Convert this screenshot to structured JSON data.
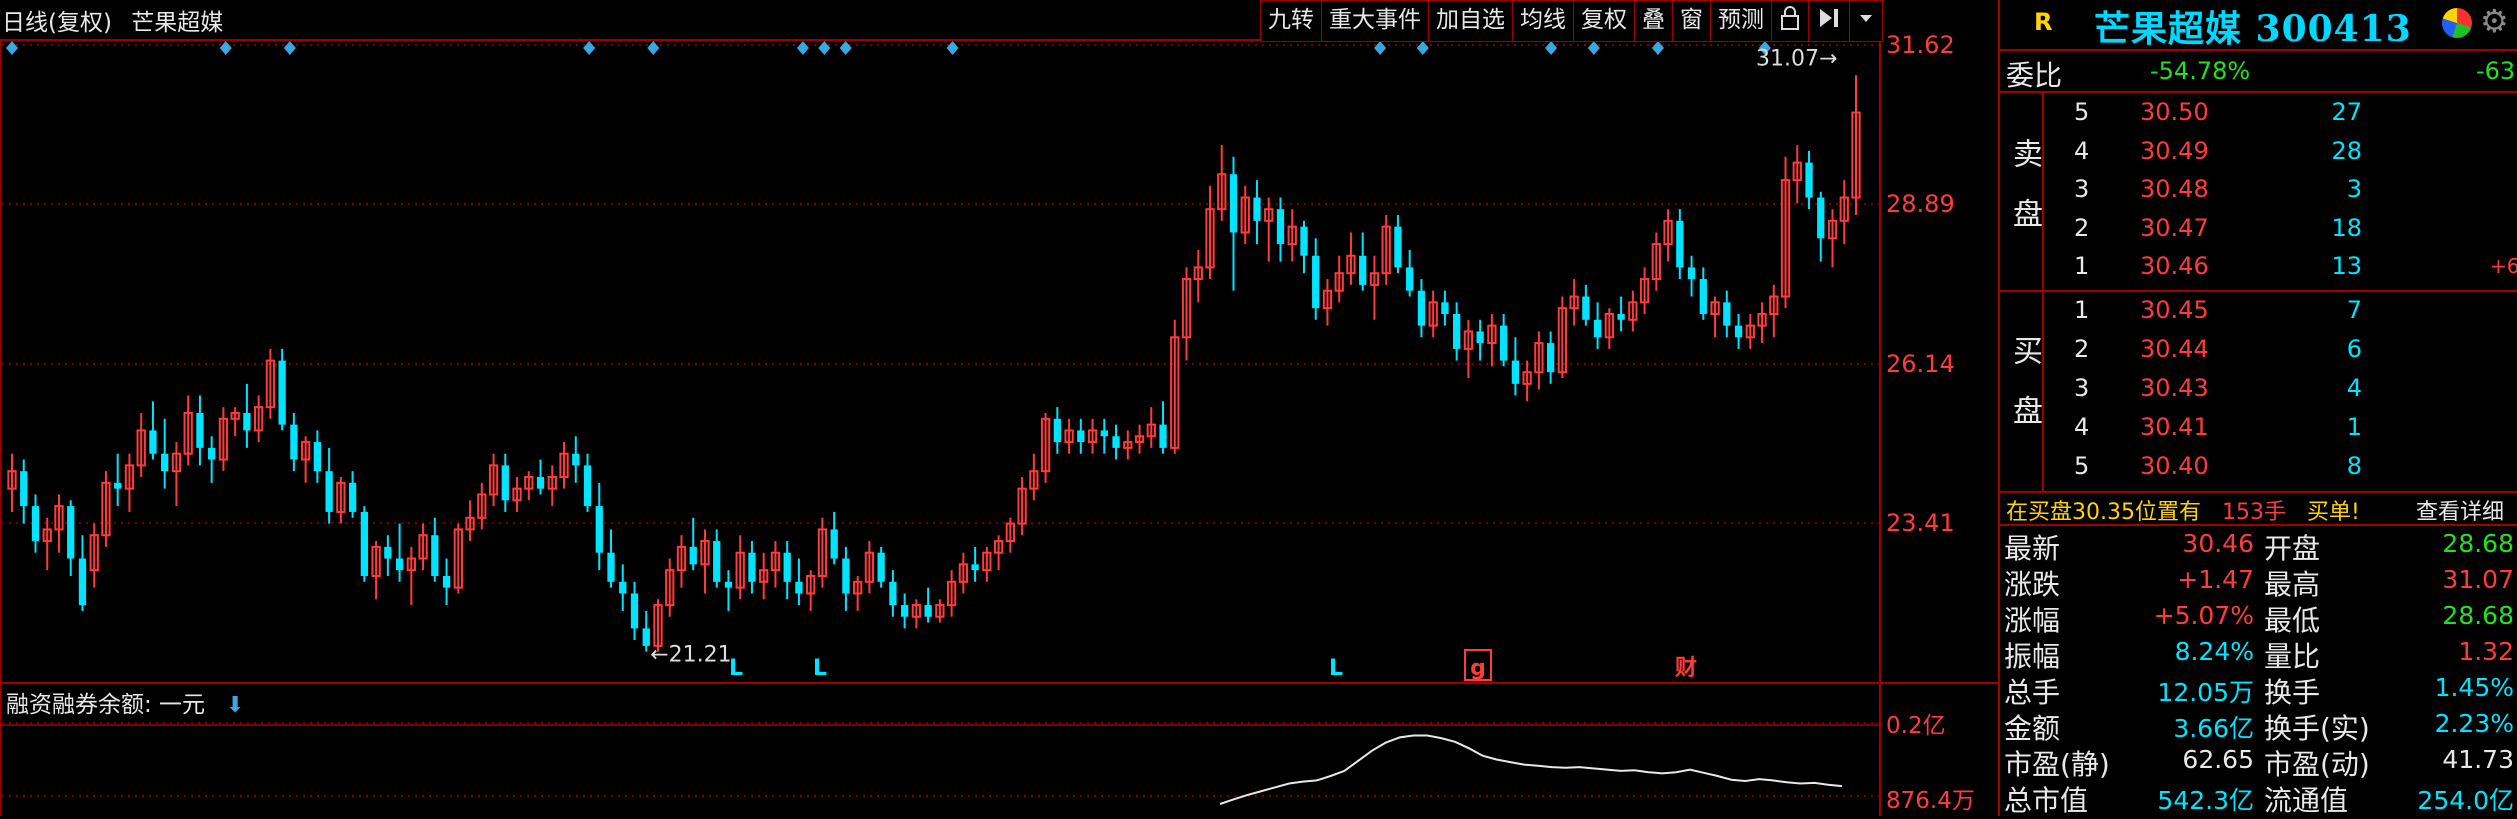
{
  "left_header": {
    "period_label": "日线(复权)",
    "stock_name": "芒果超媒"
  },
  "toolbar": {
    "items": [
      "九转",
      "重大事件",
      "加自选",
      "均线",
      "复权",
      "叠",
      "窗",
      "预测"
    ]
  },
  "price_axis": {
    "labels": [
      "31.62",
      "28.89",
      "26.14",
      "23.41"
    ],
    "values": [
      31.62,
      28.89,
      26.14,
      23.41
    ]
  },
  "annotations": {
    "high_label": "31.07",
    "low_label": "21.21",
    "markers": [
      "L",
      "L",
      "L",
      "g",
      "财"
    ]
  },
  "lower_panel": {
    "title": "融资融券余额: 一元",
    "axis_labels": [
      "0.2亿",
      "876.4万"
    ]
  },
  "colors": {
    "up": "#ff3b3b",
    "down": "#00e5ff",
    "grid": "#a00000",
    "axis_text": "#ff3b3b"
  },
  "chart_data": {
    "type": "candlestick",
    "ylim": [
      20.5,
      31.9
    ],
    "candles": [
      [
        24.0,
        24.6,
        23.6,
        24.3
      ],
      [
        24.3,
        24.5,
        23.4,
        23.7
      ],
      [
        23.7,
        23.9,
        22.9,
        23.1
      ],
      [
        23.1,
        23.5,
        22.6,
        23.3
      ],
      [
        23.3,
        23.9,
        22.9,
        23.7
      ],
      [
        23.7,
        23.8,
        22.5,
        22.8
      ],
      [
        22.8,
        23.2,
        21.9,
        22.0
      ],
      [
        22.6,
        23.4,
        22.3,
        23.2
      ],
      [
        23.2,
        24.3,
        23.0,
        24.1
      ],
      [
        24.1,
        24.6,
        23.7,
        24.0
      ],
      [
        24.0,
        24.6,
        23.6,
        24.4
      ],
      [
        24.4,
        25.3,
        24.2,
        25.0
      ],
      [
        25.0,
        25.5,
        24.5,
        24.6
      ],
      [
        24.6,
        25.2,
        24.0,
        24.3
      ],
      [
        24.3,
        24.8,
        23.7,
        24.6
      ],
      [
        24.6,
        25.6,
        24.4,
        25.3
      ],
      [
        25.3,
        25.6,
        24.4,
        24.7
      ],
      [
        24.7,
        24.9,
        24.1,
        24.5
      ],
      [
        24.5,
        25.4,
        24.3,
        25.2
      ],
      [
        25.2,
        25.4,
        24.9,
        25.3
      ],
      [
        25.3,
        25.8,
        24.7,
        25.0
      ],
      [
        25.0,
        25.6,
        24.8,
        25.4
      ],
      [
        25.4,
        26.4,
        25.2,
        26.2
      ],
      [
        26.2,
        26.4,
        25.0,
        25.1
      ],
      [
        25.1,
        25.3,
        24.3,
        24.5
      ],
      [
        24.5,
        24.9,
        24.1,
        24.8
      ],
      [
        24.8,
        25.0,
        24.1,
        24.3
      ],
      [
        24.3,
        24.7,
        23.4,
        23.6
      ],
      [
        23.6,
        24.2,
        23.4,
        24.1
      ],
      [
        24.1,
        24.3,
        23.5,
        23.6
      ],
      [
        23.6,
        23.7,
        22.4,
        22.5
      ],
      [
        22.5,
        23.1,
        22.1,
        23.0
      ],
      [
        23.0,
        23.2,
        22.5,
        22.8
      ],
      [
        22.8,
        23.4,
        22.4,
        22.6
      ],
      [
        22.6,
        23.0,
        22.0,
        22.8
      ],
      [
        22.8,
        23.4,
        22.6,
        23.2
      ],
      [
        23.2,
        23.5,
        22.4,
        22.5
      ],
      [
        22.5,
        22.8,
        22.0,
        22.3
      ],
      [
        22.3,
        23.4,
        22.2,
        23.3
      ],
      [
        23.3,
        23.8,
        23.1,
        23.5
      ],
      [
        23.5,
        24.1,
        23.3,
        23.9
      ],
      [
        23.9,
        24.6,
        23.7,
        24.4
      ],
      [
        24.4,
        24.6,
        23.6,
        23.8
      ],
      [
        23.8,
        24.2,
        23.6,
        24.0
      ],
      [
        24.0,
        24.3,
        23.8,
        24.2
      ],
      [
        24.2,
        24.5,
        23.9,
        24.0
      ],
      [
        24.0,
        24.4,
        23.7,
        24.2
      ],
      [
        24.2,
        24.8,
        24.0,
        24.6
      ],
      [
        24.6,
        24.9,
        24.1,
        24.4
      ],
      [
        24.4,
        24.6,
        23.6,
        23.7
      ],
      [
        23.7,
        24.1,
        22.6,
        22.9
      ],
      [
        22.9,
        23.3,
        22.3,
        22.4
      ],
      [
        22.4,
        22.7,
        21.9,
        22.2
      ],
      [
        22.2,
        22.4,
        21.4,
        21.6
      ],
      [
        21.6,
        21.9,
        21.2,
        21.3
      ],
      [
        21.3,
        22.1,
        21.2,
        22.0
      ],
      [
        22.0,
        22.8,
        21.8,
        22.6
      ],
      [
        22.6,
        23.2,
        22.3,
        23.0
      ],
      [
        23.0,
        23.5,
        22.6,
        22.7
      ],
      [
        22.7,
        23.3,
        22.2,
        23.1
      ],
      [
        23.1,
        23.3,
        22.3,
        22.4
      ],
      [
        22.4,
        22.6,
        21.9,
        22.3
      ],
      [
        22.3,
        23.2,
        22.1,
        22.9
      ],
      [
        22.9,
        23.1,
        22.2,
        22.4
      ],
      [
        22.4,
        22.9,
        22.1,
        22.6
      ],
      [
        22.6,
        23.1,
        22.3,
        22.9
      ],
      [
        22.9,
        23.1,
        22.1,
        22.4
      ],
      [
        22.4,
        22.8,
        22.0,
        22.2
      ],
      [
        22.2,
        22.6,
        21.9,
        22.5
      ],
      [
        22.5,
        23.5,
        22.3,
        23.3
      ],
      [
        23.3,
        23.6,
        22.7,
        22.8
      ],
      [
        22.8,
        23.0,
        21.9,
        22.2
      ],
      [
        22.2,
        22.5,
        21.9,
        22.4
      ],
      [
        22.4,
        23.1,
        22.2,
        22.9
      ],
      [
        22.9,
        23.0,
        22.3,
        22.4
      ],
      [
        22.4,
        22.6,
        21.8,
        22.0
      ],
      [
        22.0,
        22.2,
        21.6,
        21.8
      ],
      [
        21.8,
        22.1,
        21.6,
        22.0
      ],
      [
        22.0,
        22.3,
        21.7,
        21.8
      ],
      [
        21.8,
        22.1,
        21.7,
        22.0
      ],
      [
        22.0,
        22.6,
        21.8,
        22.4
      ],
      [
        22.4,
        22.9,
        22.2,
        22.7
      ],
      [
        22.7,
        23.0,
        22.4,
        22.6
      ],
      [
        22.6,
        23.0,
        22.4,
        22.9
      ],
      [
        22.9,
        23.2,
        22.6,
        23.1
      ],
      [
        23.1,
        23.5,
        22.9,
        23.4
      ],
      [
        23.4,
        24.2,
        23.2,
        24.0
      ],
      [
        24.0,
        24.6,
        23.8,
        24.3
      ],
      [
        24.3,
        25.3,
        24.1,
        25.2
      ],
      [
        25.2,
        25.4,
        24.6,
        24.8
      ],
      [
        24.8,
        25.2,
        24.6,
        25.0
      ],
      [
        25.0,
        25.2,
        24.6,
        24.8
      ],
      [
        24.8,
        25.2,
        24.6,
        25.0
      ],
      [
        25.0,
        25.2,
        24.6,
        24.9
      ],
      [
        24.9,
        25.1,
        24.5,
        24.7
      ],
      [
        24.7,
        25.0,
        24.5,
        24.8
      ],
      [
        24.8,
        25.1,
        24.6,
        24.9
      ],
      [
        24.9,
        25.4,
        24.7,
        25.1
      ],
      [
        25.1,
        25.5,
        24.6,
        24.7
      ],
      [
        24.7,
        26.9,
        24.6,
        26.6
      ],
      [
        26.6,
        27.8,
        26.2,
        27.6
      ],
      [
        27.6,
        28.1,
        27.2,
        27.8
      ],
      [
        27.8,
        29.2,
        27.6,
        28.8
      ],
      [
        28.8,
        29.9,
        28.6,
        29.4
      ],
      [
        29.4,
        29.7,
        27.4,
        28.4
      ],
      [
        28.4,
        29.2,
        28.2,
        29.0
      ],
      [
        29.0,
        29.3,
        28.2,
        28.6
      ],
      [
        28.6,
        29.0,
        27.9,
        28.8
      ],
      [
        28.8,
        29.0,
        27.9,
        28.2
      ],
      [
        28.2,
        28.8,
        27.9,
        28.5
      ],
      [
        28.5,
        28.6,
        27.7,
        28.0
      ],
      [
        28.0,
        28.3,
        26.9,
        27.1
      ],
      [
        27.1,
        27.6,
        26.8,
        27.4
      ],
      [
        27.4,
        28.0,
        27.2,
        27.7
      ],
      [
        27.7,
        28.4,
        27.5,
        28.0
      ],
      [
        28.0,
        28.4,
        27.4,
        27.5
      ],
      [
        27.5,
        28.0,
        26.9,
        27.7
      ],
      [
        27.7,
        28.7,
        27.5,
        28.5
      ],
      [
        28.5,
        28.7,
        27.7,
        27.8
      ],
      [
        27.8,
        28.1,
        27.3,
        27.4
      ],
      [
        27.4,
        27.6,
        26.6,
        26.8
      ],
      [
        26.8,
        27.4,
        26.6,
        27.2
      ],
      [
        27.2,
        27.4,
        26.8,
        27.0
      ],
      [
        27.0,
        27.2,
        26.2,
        26.4
      ],
      [
        26.4,
        26.9,
        25.9,
        26.7
      ],
      [
        26.7,
        26.9,
        26.2,
        26.5
      ],
      [
        26.5,
        27.0,
        26.1,
        26.8
      ],
      [
        26.8,
        27.0,
        26.1,
        26.2
      ],
      [
        26.2,
        26.6,
        25.6,
        25.8
      ],
      [
        25.8,
        26.2,
        25.5,
        26.0
      ],
      [
        26.0,
        26.7,
        25.7,
        26.5
      ],
      [
        26.5,
        26.7,
        25.8,
        26.0
      ],
      [
        26.0,
        27.3,
        25.9,
        27.1
      ],
      [
        27.1,
        27.6,
        26.8,
        27.3
      ],
      [
        27.3,
        27.5,
        26.8,
        26.9
      ],
      [
        26.9,
        27.2,
        26.4,
        26.6
      ],
      [
        26.6,
        27.1,
        26.4,
        27.0
      ],
      [
        27.0,
        27.3,
        26.7,
        26.9
      ],
      [
        26.9,
        27.4,
        26.7,
        27.2
      ],
      [
        27.2,
        27.8,
        27.0,
        27.6
      ],
      [
        27.6,
        28.4,
        27.4,
        28.2
      ],
      [
        28.2,
        28.8,
        27.9,
        28.6
      ],
      [
        28.6,
        28.8,
        27.6,
        27.8
      ],
      [
        27.8,
        28.0,
        27.3,
        27.6
      ],
      [
        27.6,
        27.8,
        26.9,
        27.0
      ],
      [
        27.0,
        27.3,
        26.6,
        27.2
      ],
      [
        27.2,
        27.4,
        26.6,
        26.8
      ],
      [
        26.8,
        27.0,
        26.4,
        26.6
      ],
      [
        26.6,
        27.0,
        26.4,
        26.8
      ],
      [
        26.8,
        27.2,
        26.5,
        27.0
      ],
      [
        27.0,
        27.5,
        26.6,
        27.3
      ],
      [
        27.3,
        29.7,
        27.1,
        29.3
      ],
      [
        29.3,
        29.9,
        28.9,
        29.6
      ],
      [
        29.6,
        29.8,
        28.8,
        29.0
      ],
      [
        29.0,
        29.1,
        27.9,
        28.3
      ],
      [
        28.3,
        28.8,
        27.8,
        28.6
      ],
      [
        28.6,
        29.3,
        28.2,
        29.0
      ],
      [
        29.0,
        31.1,
        28.7,
        30.46
      ]
    ],
    "lower_series": [
      0.00876,
      0.0095,
      0.0102,
      0.0108,
      0.0114,
      0.012,
      0.0123,
      0.0125,
      0.0132,
      0.014,
      0.0156,
      0.0172,
      0.0185,
      0.0193,
      0.0196,
      0.0196,
      0.0192,
      0.0186,
      0.0176,
      0.0164,
      0.0158,
      0.0154,
      0.015,
      0.0148,
      0.0146,
      0.0145,
      0.0146,
      0.0144,
      0.0142,
      0.014,
      0.0141,
      0.0138,
      0.0136,
      0.0138,
      0.0142,
      0.0137,
      0.0132,
      0.0126,
      0.0124,
      0.0127,
      0.0125,
      0.0122,
      0.012,
      0.0121,
      0.0118,
      0.0116
    ]
  },
  "quote": {
    "title": "芒果超媒 300413",
    "r_label": "R",
    "weibi": {
      "label": "委比",
      "pct": "-54.78%",
      "diff": "-63"
    },
    "sell_label": "卖盘",
    "buy_label": "买盘",
    "sells": [
      {
        "lvl": "5",
        "price": "30.50",
        "vol": "27",
        "chg": ""
      },
      {
        "lvl": "4",
        "price": "30.49",
        "vol": "28",
        "chg": ""
      },
      {
        "lvl": "3",
        "price": "30.48",
        "vol": "3",
        "chg": ""
      },
      {
        "lvl": "2",
        "price": "30.47",
        "vol": "18",
        "chg": ""
      },
      {
        "lvl": "1",
        "price": "30.46",
        "vol": "13",
        "chg": "+6"
      }
    ],
    "buys": [
      {
        "lvl": "1",
        "price": "30.45",
        "vol": "7"
      },
      {
        "lvl": "2",
        "price": "30.44",
        "vol": "6"
      },
      {
        "lvl": "3",
        "price": "30.43",
        "vol": "4"
      },
      {
        "lvl": "4",
        "price": "30.41",
        "vol": "1"
      },
      {
        "lvl": "5",
        "price": "30.40",
        "vol": "8"
      }
    ],
    "notice": {
      "text": "在买盘30.35位置有",
      "qty": "153手",
      "tail": "买单!",
      "link": "查看详细"
    },
    "stats": [
      {
        "l1": "最新",
        "v1": "30.46",
        "c1": "red",
        "l2": "开盘",
        "v2": "28.68",
        "c2": "green"
      },
      {
        "l1": "涨跌",
        "v1": "+1.47",
        "c1": "red",
        "l2": "最高",
        "v2": "31.07",
        "c2": "red"
      },
      {
        "l1": "涨幅",
        "v1": "+5.07%",
        "c1": "red",
        "l2": "最低",
        "v2": "28.68",
        "c2": "green"
      },
      {
        "l1": "振幅",
        "v1": "8.24%",
        "c1": "cyan",
        "l2": "量比",
        "v2": "1.32",
        "c2": "red"
      },
      {
        "l1": "总手",
        "v1": "12.05万",
        "c1": "cyan",
        "l2": "换手",
        "v2": "1.45%",
        "c2": "cyan"
      },
      {
        "l1": "金额",
        "v1": "3.66亿",
        "c1": "cyan",
        "l2": "换手(实)",
        "v2": "2.23%",
        "c2": "cyan"
      },
      {
        "l1": "市盈(静)",
        "v1": "62.65",
        "c1": "white",
        "l2": "市盈(动)",
        "v2": "41.73",
        "c2": "white"
      },
      {
        "l1": "总市值",
        "v1": "542.3亿",
        "c1": "cyan",
        "l2": "流通值",
        "v2": "254.0亿",
        "c2": "cyan"
      }
    ]
  }
}
